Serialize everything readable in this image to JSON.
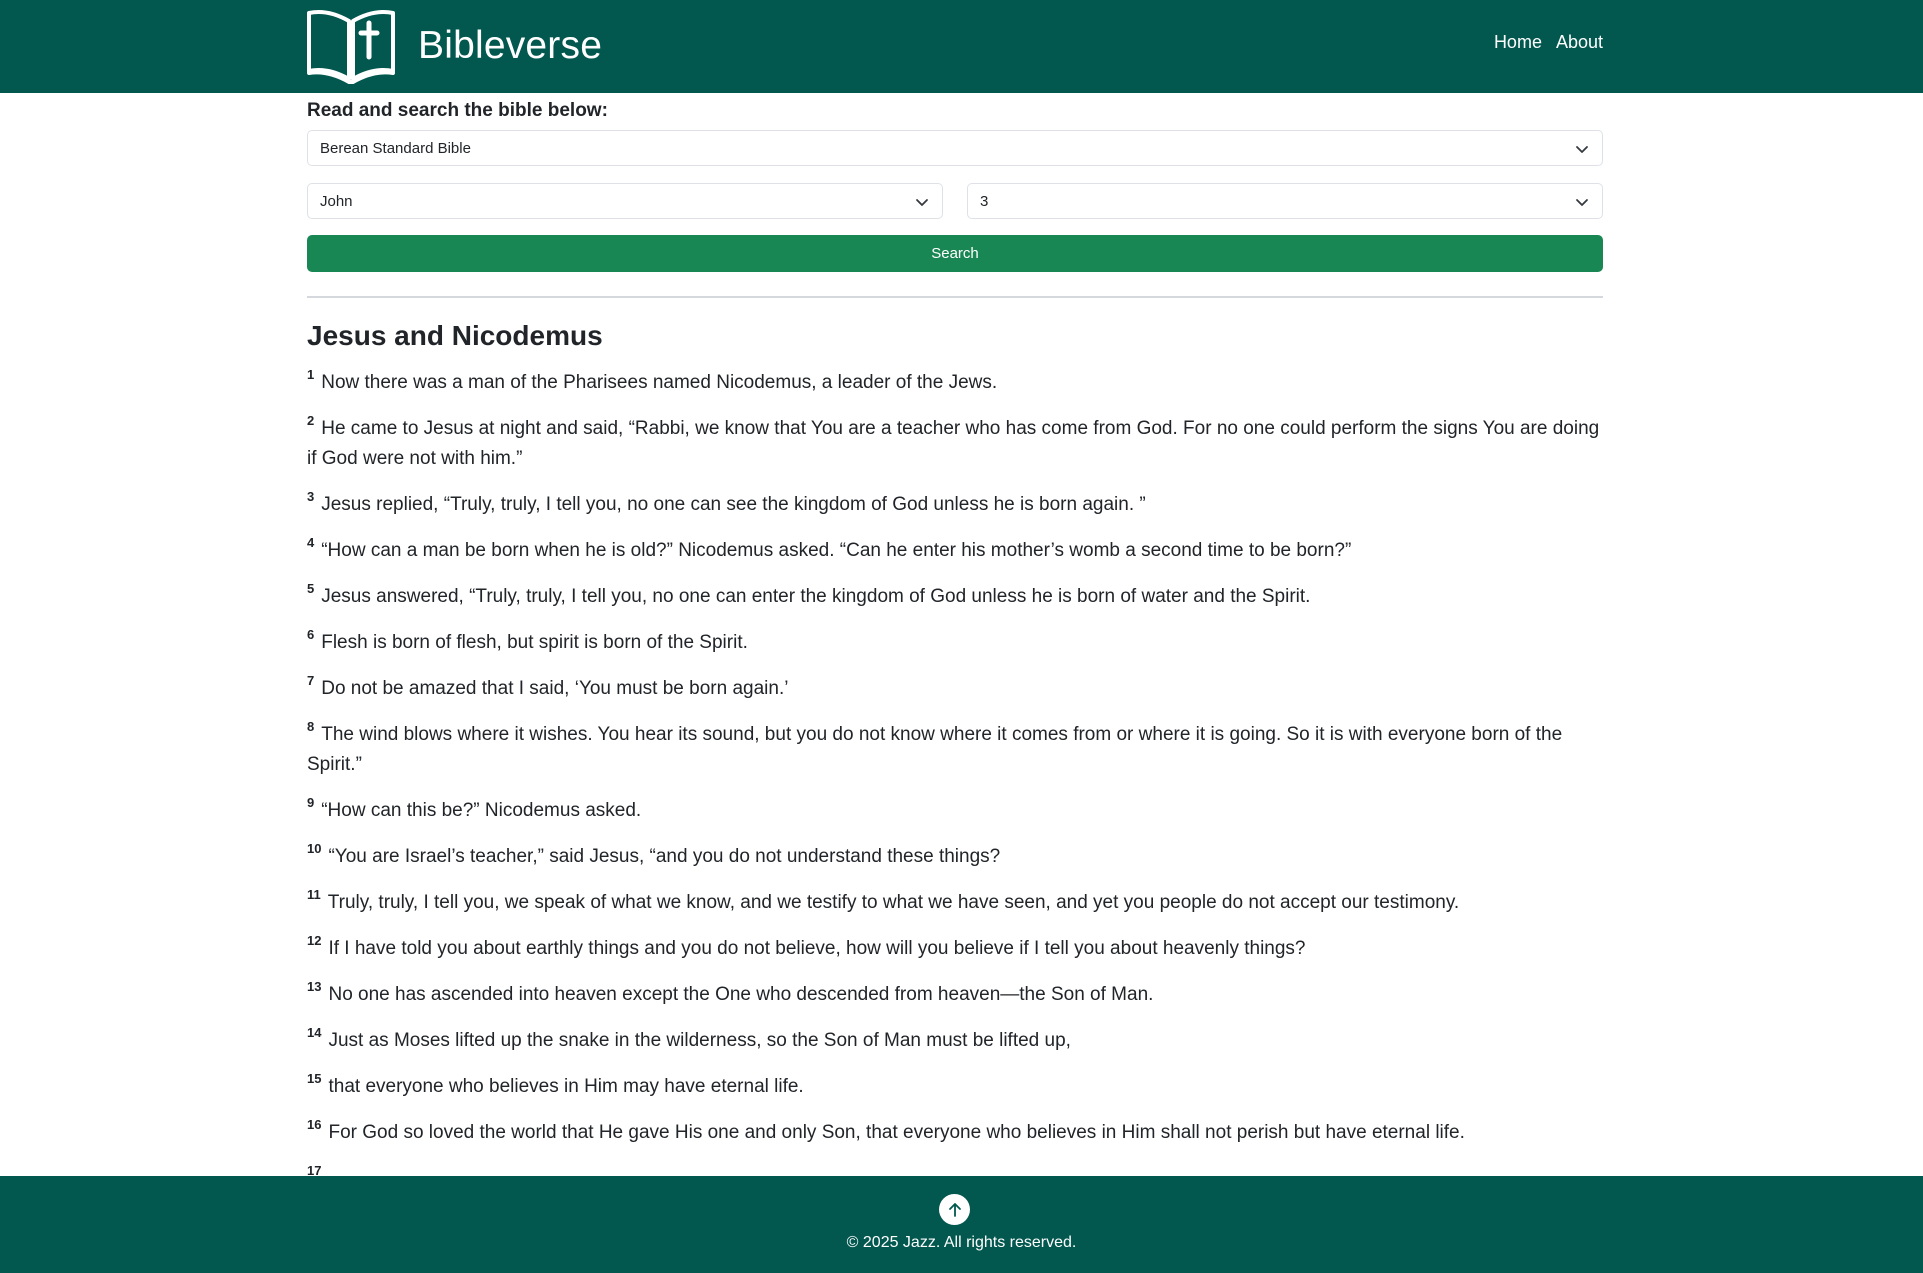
{
  "header": {
    "brand": "Bibleverse",
    "nav": [
      "Home",
      "About"
    ]
  },
  "search": {
    "label": "Read and search the bible below:",
    "version": "Berean Standard Bible",
    "book": "John",
    "chapter": "3",
    "button": "Search"
  },
  "chapter": {
    "title": "Jesus and Nicodemus",
    "verses": [
      {
        "num": "1",
        "text": "Now there was a man of the Pharisees named Nicodemus, a leader of the Jews."
      },
      {
        "num": "2",
        "text": "He came to Jesus at night and said, “Rabbi, we know that You are a teacher who has come from God. For no one could perform the signs You are doing if God were not with him.”"
      },
      {
        "num": "3",
        "text": "Jesus replied, “Truly, truly, I tell you, no one can see the kingdom of God unless he is born again.   ”"
      },
      {
        "num": "4",
        "text": "“How can a man be born when he is old?” Nicodemus asked. “Can he enter his mother’s womb a second time to be born?”"
      },
      {
        "num": "5",
        "text": "Jesus answered, “Truly, truly, I tell you, no one can enter the kingdom of God unless he is born of water and the Spirit."
      },
      {
        "num": "6",
        "text": "Flesh is born of flesh, but spirit is born of the Spirit."
      },
      {
        "num": "7",
        "text": "Do not be amazed that I said, ‘You   must be born again.’"
      },
      {
        "num": "8",
        "text": "The wind blows where it wishes. You hear its sound, but you do not know where it comes from or where it is going. So it is with everyone born of the Spirit.”"
      },
      {
        "num": "9",
        "text": "“How can this be?” Nicodemus asked."
      },
      {
        "num": "10",
        "text": "“You are Israel’s teacher,” said Jesus, “and you do not understand these things?"
      },
      {
        "num": "11",
        "text": "Truly, truly, I tell you, we speak of what we know, and we testify to what we have seen, and yet you people do not accept our testimony."
      },
      {
        "num": "12",
        "text": "If I have told you about earthly things and you do not believe, how will you believe if I tell you about heavenly things?"
      },
      {
        "num": "13",
        "text": "No one has ascended into heaven except the One who descended from heaven—the Son of Man."
      },
      {
        "num": "14",
        "text": "Just as Moses lifted up the snake in the wilderness, so the Son of Man must be lifted up,"
      },
      {
        "num": "15",
        "text": "that everyone who believes in Him may have eternal life."
      },
      {
        "num": "16",
        "text": "For God so loved the world that He gave His one and only   Son, that everyone who believes in Him shall not perish but have eternal life."
      },
      {
        "num": "17",
        "text": ""
      }
    ]
  },
  "footer": {
    "copyright": "© 2025 Jazz. All rights reserved.",
    "back_to_top_icon": "arrow-up-icon"
  },
  "colors": {
    "brand_dark_green": "#02574f",
    "search_button_green": "#198754"
  }
}
